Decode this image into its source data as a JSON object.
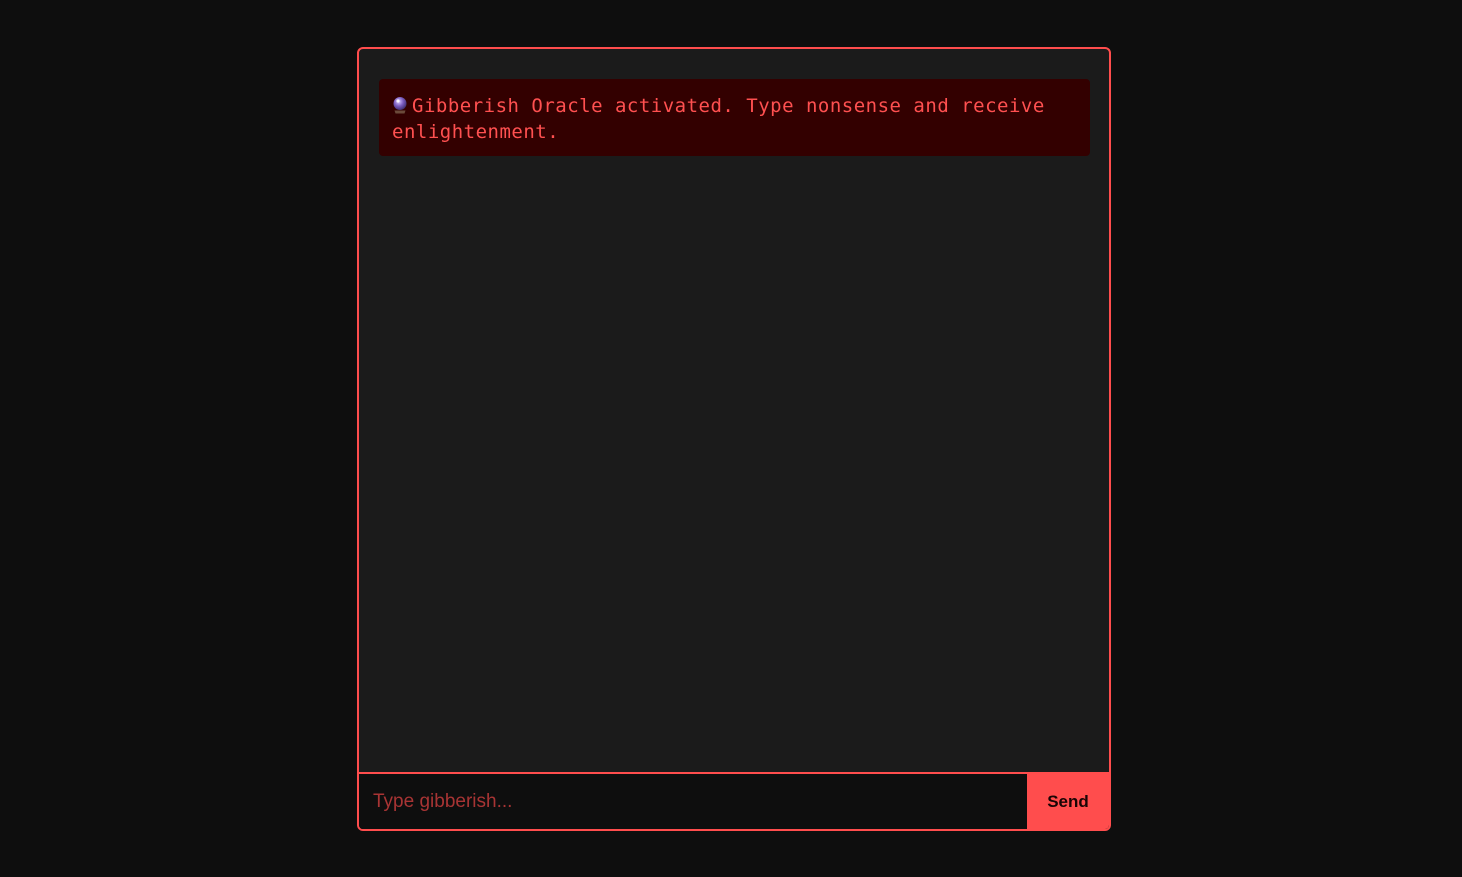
{
  "oracle": {
    "icon": "crystal-ball-icon",
    "welcome_message": "Gibberish Oracle activated. Type nonsense and receive enlightenment."
  },
  "composer": {
    "placeholder": "Type gibberish...",
    "value": "",
    "send_label": "Send"
  },
  "colors": {
    "accent": "#ff4d4d",
    "page_background": "#0e0e0e",
    "panel_background": "#1b1b1b",
    "message_background": "#330000",
    "message_text": "#ff5050"
  }
}
